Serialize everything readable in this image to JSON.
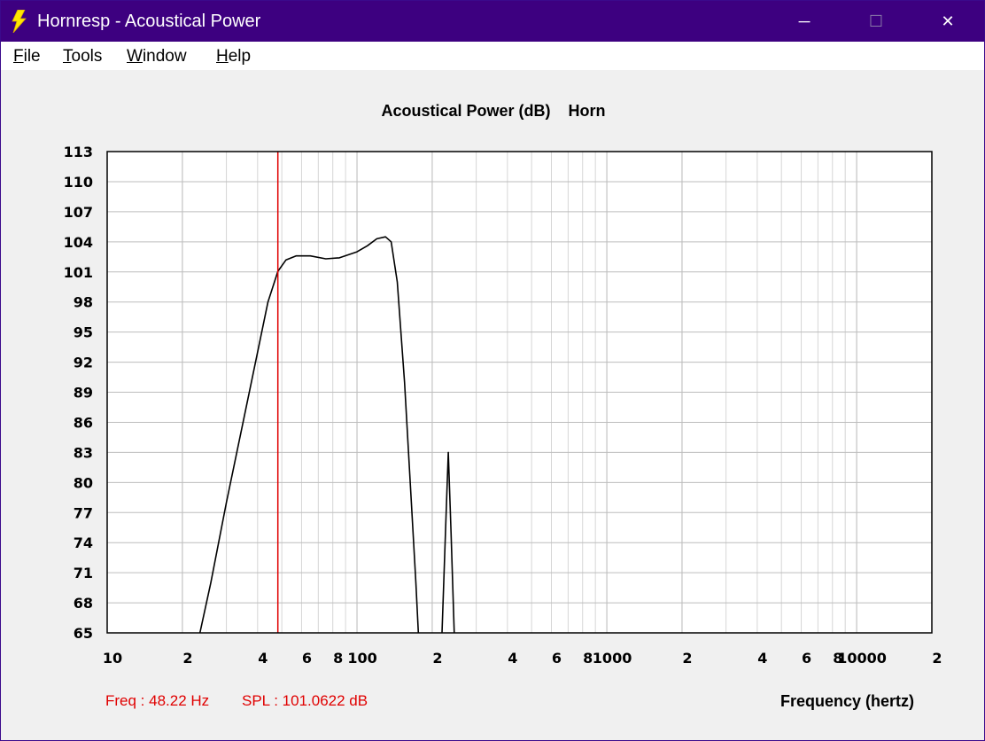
{
  "window": {
    "title": "Hornresp - Acoustical Power",
    "minimize_glyph": "─",
    "maximize_glyph": "☐",
    "close_glyph": "✕",
    "titlebar_color": "#3d0080",
    "icon": "lightning-bolt-icon"
  },
  "menu": {
    "items": [
      {
        "key": "F",
        "rest": "ile"
      },
      {
        "key": "T",
        "rest": "ools"
      },
      {
        "key": "W",
        "rest": "indow"
      },
      {
        "key": "H",
        "rest": "elp"
      }
    ]
  },
  "readout": {
    "freq": "Freq : 48.22 Hz",
    "spl": "SPL : 101.0622 dB"
  },
  "chart_data": {
    "type": "line",
    "title": "Acoustical Power (dB)    Horn",
    "xlabel": "Frequency (hertz)",
    "x_scale": "log",
    "xlim": [
      10,
      20000
    ],
    "ylim": [
      65,
      113
    ],
    "y_ticks": [
      113,
      110,
      107,
      104,
      101,
      98,
      95,
      92,
      89,
      86,
      83,
      80,
      77,
      74,
      71,
      68,
      65
    ],
    "x_ticks": [
      {
        "value": 10,
        "label": "10"
      },
      {
        "value": 20,
        "label": "2"
      },
      {
        "value": 40,
        "label": "4"
      },
      {
        "value": 60,
        "label": "6"
      },
      {
        "value": 80,
        "label": "8"
      },
      {
        "value": 100,
        "label": "100"
      },
      {
        "value": 200,
        "label": "2"
      },
      {
        "value": 400,
        "label": "4"
      },
      {
        "value": 600,
        "label": "6"
      },
      {
        "value": 800,
        "label": "8"
      },
      {
        "value": 1000,
        "label": "1000"
      },
      {
        "value": 2000,
        "label": "2"
      },
      {
        "value": 4000,
        "label": "4"
      },
      {
        "value": 6000,
        "label": "6"
      },
      {
        "value": 8000,
        "label": "8"
      },
      {
        "value": 10000,
        "label": "10000"
      },
      {
        "value": 20000,
        "label": "2"
      }
    ],
    "grid": true,
    "cursor_freq": 48.22,
    "cursor_color": "#e00000",
    "line_color": "#000000",
    "series": [
      {
        "segments": [
          [
            [
              23.5,
              65
            ],
            [
              26,
              70
            ],
            [
              30,
              78
            ],
            [
              35,
              86
            ],
            [
              40,
              93
            ],
            [
              44,
              98
            ],
            [
              48.22,
              101.06
            ],
            [
              52,
              102.2
            ],
            [
              57,
              102.6
            ],
            [
              65,
              102.6
            ],
            [
              75,
              102.3
            ],
            [
              85,
              102.4
            ],
            [
              100,
              103
            ],
            [
              110,
              103.6
            ],
            [
              120,
              104.3
            ],
            [
              130,
              104.5
            ],
            [
              137,
              104
            ],
            [
              145,
              100
            ],
            [
              155,
              90
            ],
            [
              165,
              78
            ],
            [
              172,
              70
            ],
            [
              176,
              65
            ]
          ],
          [
            [
              219,
              65
            ],
            [
              226,
              75
            ],
            [
              232,
              83
            ],
            [
              238,
              75
            ],
            [
              245,
              65
            ]
          ]
        ]
      }
    ]
  }
}
